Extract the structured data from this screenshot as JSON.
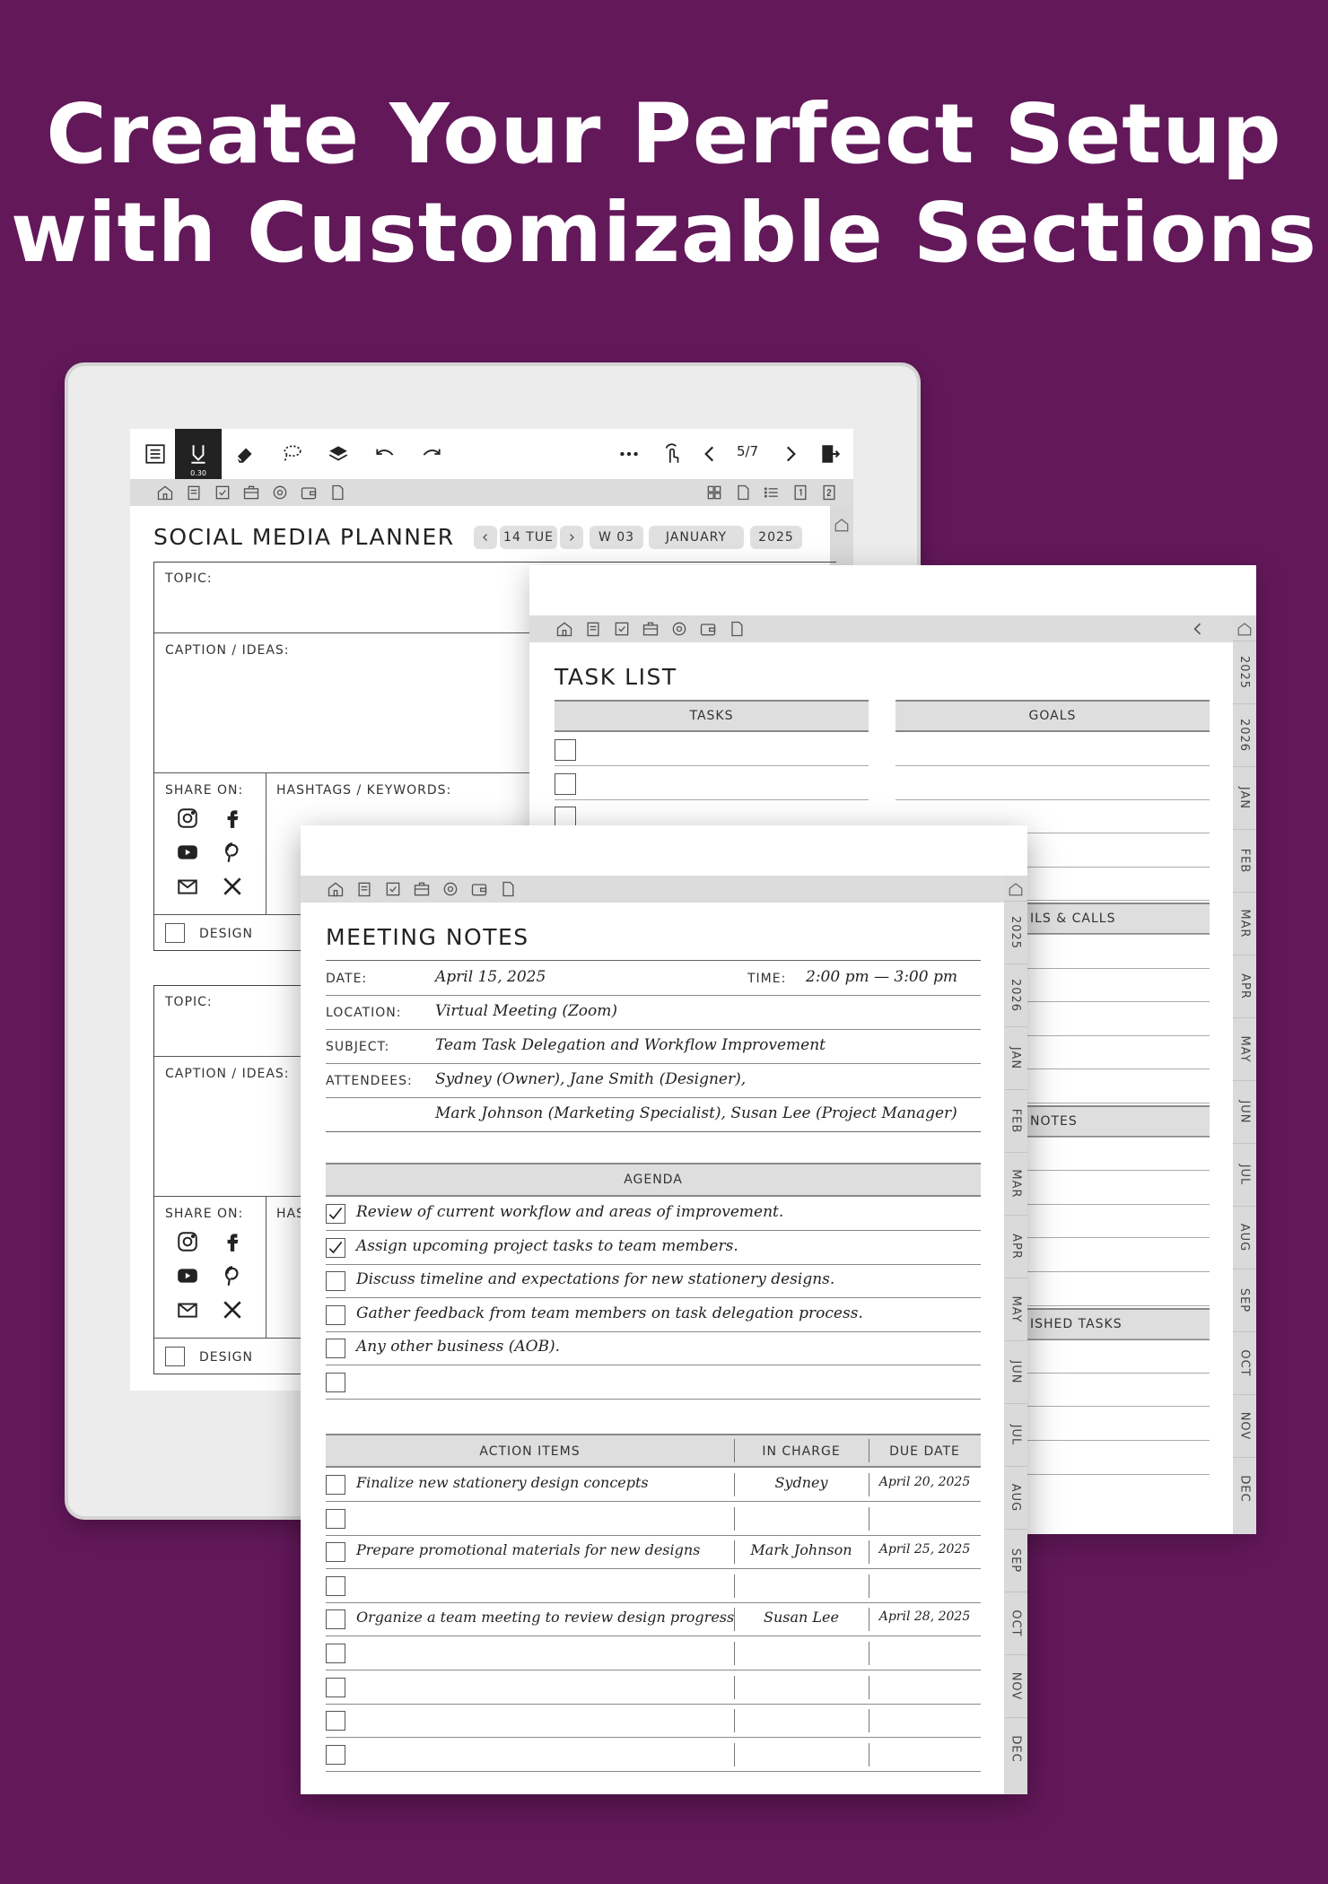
{
  "headline": {
    "line1": "Create Your Perfect Setup",
    "line2": "with Customizable Sections"
  },
  "colors": {
    "background": "#63185a",
    "tab_gray": "#dadada",
    "header_gray": "#dedede"
  },
  "toolbar": {
    "icons": [
      "menu-icon",
      "pen-icon",
      "eraser-icon",
      "lasso-icon",
      "layers-icon",
      "undo-icon",
      "redo-icon",
      "more-icon",
      "touch-icon",
      "prev-page-icon",
      "next-page-icon",
      "exit-icon"
    ],
    "pen_size": "0.30",
    "page_indicator": "5/7"
  },
  "social": {
    "title": "SOCIAL MEDIA PLANNER",
    "date_pill": "14 TUE",
    "week_pill": "W 03",
    "month_pill": "JANUARY",
    "year_pill": "2025",
    "topic_label": "TOPIC:",
    "caption_label": "CAPTION / IDEAS:",
    "share_label": "SHARE ON:",
    "hashtags_label": "HASHTAGS / KEYWORDS:",
    "hashtags_label_cut": "HAS",
    "design_label": "DESIGN"
  },
  "task": {
    "title": "TASK LIST",
    "tasks_header": "TASKS",
    "goals_header": "GOALS",
    "calls_header": "ILS & CALLS",
    "notes_header": "NOTES",
    "finished_header": "ISHED TASKS",
    "side_tabs": [
      "2025",
      "2026",
      "JAN",
      "FEB",
      "MAR",
      "APR",
      "MAY",
      "JUN",
      "JUL",
      "AUG",
      "SEP",
      "OCT",
      "NOV",
      "DEC"
    ]
  },
  "meeting": {
    "title": "MEETING NOTES",
    "date_label": "DATE:",
    "date_value": "April 15, 2025",
    "time_label": "TIME:",
    "time_value": "2:00 pm — 3:00 pm",
    "location_label": "LOCATION:",
    "location_value": "Virtual Meeting (Zoom)",
    "subject_label": "SUBJECT:",
    "subject_value": "Team Task Delegation and Workflow Improvement",
    "attendees_label": "ATTENDEES:",
    "attendees_line1": "Sydney (Owner), Jane Smith (Designer),",
    "attendees_line2": "Mark Johnson (Marketing Specialist), Susan Lee (Project Manager)",
    "agenda_header": "AGENDA",
    "agenda": [
      {
        "text": "Review of current workflow and areas of improvement.",
        "checked": true
      },
      {
        "text": "Assign upcoming project tasks to team members.",
        "checked": true
      },
      {
        "text": "Discuss timeline and expectations for new stationery designs.",
        "checked": false
      },
      {
        "text": "Gather feedback from team members on task delegation process.",
        "checked": false
      },
      {
        "text": "Any other business (AOB).",
        "checked": false
      },
      {
        "text": "",
        "checked": false
      }
    ],
    "action_header": "ACTION ITEMS",
    "incharge_header": "IN CHARGE",
    "due_header": "DUE DATE",
    "actions": [
      {
        "item": "Finalize new stationery design concepts",
        "who": "Sydney",
        "due": "April 20, 2025"
      },
      {
        "item": "",
        "who": "",
        "due": ""
      },
      {
        "item": "Prepare promotional materials for new designs",
        "who": "Mark Johnson",
        "due": "April 25, 2025"
      },
      {
        "item": "",
        "who": "",
        "due": ""
      },
      {
        "item": "Organize a team meeting to review design progress",
        "who": "Susan Lee",
        "due": "April 28, 2025"
      },
      {
        "item": "",
        "who": "",
        "due": ""
      },
      {
        "item": "",
        "who": "",
        "due": ""
      },
      {
        "item": "",
        "who": "",
        "due": ""
      },
      {
        "item": "",
        "who": "",
        "due": ""
      }
    ],
    "side_tabs": [
      "2025",
      "2026",
      "JAN",
      "FEB",
      "MAR",
      "APR",
      "MAY",
      "JUN",
      "JUL",
      "AUG",
      "SEP",
      "OCT",
      "NOV",
      "DEC"
    ]
  }
}
